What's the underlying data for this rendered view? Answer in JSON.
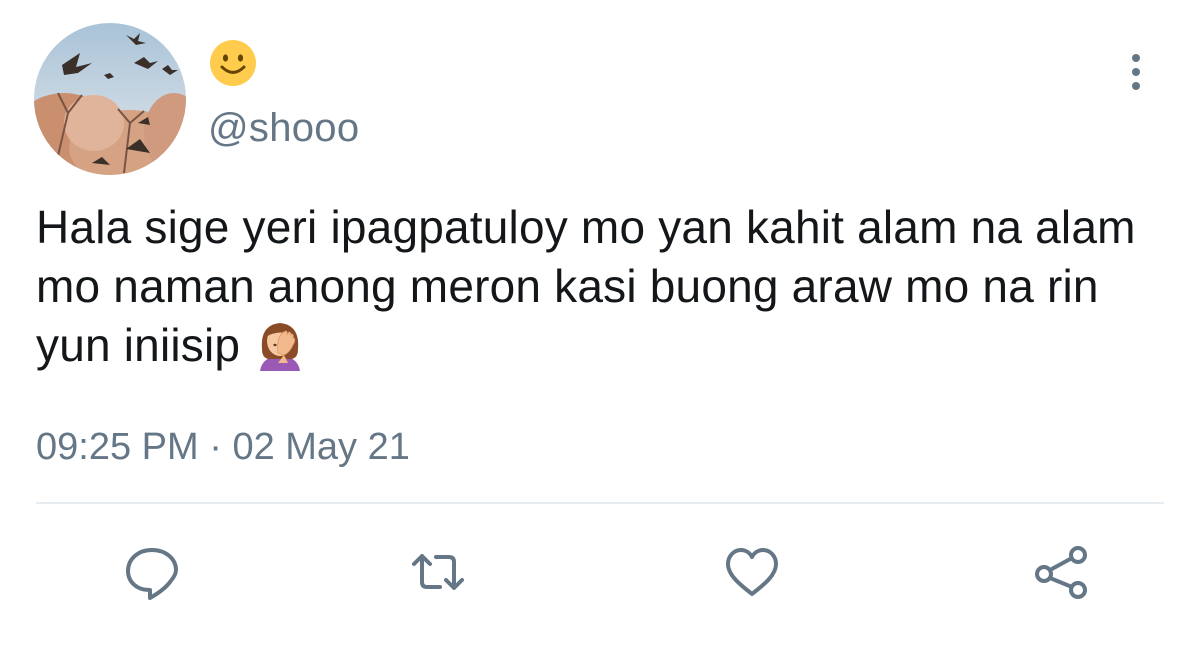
{
  "tweet": {
    "display_name_emoji": "slightly-smiling-face-emoji",
    "handle": "@shooo",
    "text": "Hala sige yeri ipagpatuloy mo yan kahit alam na alam mo naman anong meron kasi buong araw mo na rin yun iniisip",
    "trailing_emoji": "person-facepalming-emoji",
    "time": "09:25 PM",
    "separator": " · ",
    "date": "02 May 21"
  },
  "actions": [
    {
      "icon": "reply-icon"
    },
    {
      "icon": "retweet-icon"
    },
    {
      "icon": "like-icon"
    },
    {
      "icon": "share-icon"
    }
  ],
  "colors": {
    "text": "#14171a",
    "secondary": "#657786",
    "divider": "#e6ecf0",
    "sky": "#b9cfe0",
    "emoji_yellow": "#ffcc4d"
  }
}
